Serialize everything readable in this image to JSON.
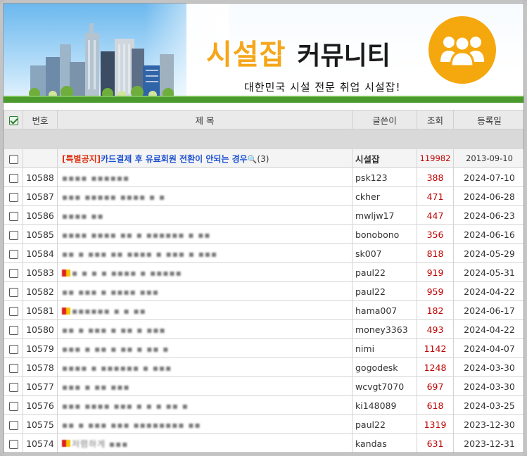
{
  "banner": {
    "title_main": "시설잡",
    "title_sub": "커뮤니티",
    "tagline": "대한민국 시설 전문 취업 시설잡!",
    "colors": {
      "accent": "#f5a61a",
      "sky": "#6bb8ee",
      "grass": "#4a9a2e"
    },
    "logo_icon": "people-group-icon"
  },
  "table": {
    "headers": {
      "number": "번호",
      "title": "제 목",
      "author": "글쓴이",
      "views": "조회",
      "date": "등록일"
    },
    "notice": {
      "tag": "[특별공지]",
      "text": "카드결제 후 유료회원 전환이 안되는 경우",
      "comment_count": "(3)",
      "author": "시설잡",
      "views": "119982",
      "date": "2013-09-10"
    },
    "rows": [
      {
        "number": "10588",
        "title": "▪▪▪▪ ▪▪▪▪▪▪",
        "author": "psk123",
        "views": "388",
        "date": "2024-07-10"
      },
      {
        "number": "10587",
        "title": "▪▪▪ ▪▪▪▪▪ ▪▪▪▪ ▪ ▪",
        "author": "ckher",
        "views": "471",
        "date": "2024-06-28"
      },
      {
        "number": "10586",
        "title": "▪▪▪▪ ▪▪",
        "author": "mwljw17",
        "views": "447",
        "date": "2024-06-23"
      },
      {
        "number": "10585",
        "title": "▪▪▪▪ ▪▪▪▪ ▪▪ ▪ ▪▪▪▪▪▪ ▪ ▪▪",
        "author": "bonobono",
        "views": "356",
        "date": "2024-06-16"
      },
      {
        "number": "10584",
        "title": "▪▪ ▪ ▪▪▪ ▪▪ ▪▪▪▪ ▪ ▪▪▪ ▪ ▪▪▪",
        "author": "sk007",
        "views": "818",
        "date": "2024-05-29"
      },
      {
        "number": "10583",
        "title": "▪ ▪ ▪ ▪ ▪▪▪▪ ▪ ▪▪▪▪▪",
        "author": "paul22",
        "views": "919",
        "date": "2024-05-31"
      },
      {
        "number": "10582",
        "title": "▪▪ ▪▪▪ ▪ ▪▪▪▪ ▪▪▪",
        "author": "paul22",
        "views": "959",
        "date": "2024-04-22"
      },
      {
        "number": "10581",
        "title": "▪▪▪▪▪▪ ▪ ▪ ▪▪",
        "author": "hama007",
        "views": "182",
        "date": "2024-06-17"
      },
      {
        "number": "10580",
        "title": "▪▪ ▪ ▪▪▪ ▪ ▪▪ ▪ ▪▪▪",
        "author": "money3363",
        "views": "493",
        "date": "2024-04-22"
      },
      {
        "number": "10579",
        "title": "▪▪▪ ▪ ▪▪ ▪ ▪▪ ▪ ▪▪ ▪",
        "author": "nimi",
        "views": "1142",
        "date": "2024-04-07"
      },
      {
        "number": "10578",
        "title": "▪▪▪▪ ▪ ▪▪▪▪▪▪ ▪ ▪▪▪",
        "author": "gogodesk",
        "views": "1248",
        "date": "2024-03-30"
      },
      {
        "number": "10577",
        "title": "▪▪▪ ▪ ▪▪ ▪▪▪",
        "author": "wcvgt7070",
        "views": "697",
        "date": "2024-03-30"
      },
      {
        "number": "10576",
        "title": "▪▪▪ ▪▪▪▪ ▪▪▪ ▪ ▪ ▪ ▪▪ ▪",
        "author": "ki148089",
        "views": "618",
        "date": "2024-03-25"
      },
      {
        "number": "10575",
        "title": "▪▪ ▪ ▪▪▪ ▪▪▪ ▪▪▪▪▪▪▪▪ ▪▪",
        "author": "paul22",
        "views": "1319",
        "date": "2023-12-30"
      },
      {
        "number": "10574",
        "title": "저렴하게 ▪▪▪",
        "author": "kandas",
        "views": "631",
        "date": "2023-12-31"
      }
    ],
    "new_icon_rows": [
      "10583",
      "10581",
      "10574"
    ]
  }
}
